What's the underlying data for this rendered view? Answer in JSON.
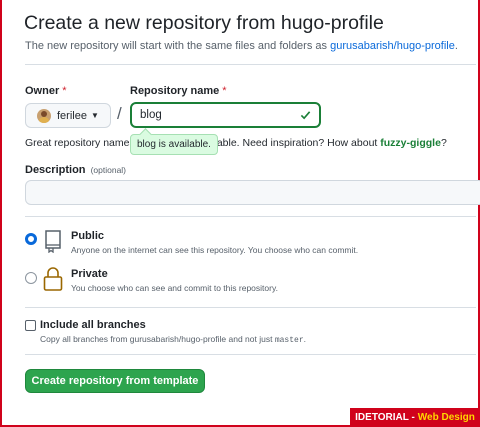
{
  "header": {
    "title": "Create a new repository from hugo-profile",
    "subtitle_prefix": "The new repository will start with the same files and folders as ",
    "subtitle_link": "gurusabarish/hugo-profile",
    "subtitle_suffix": "."
  },
  "owner": {
    "label": "Owner",
    "required_mark": "*",
    "value": "ferilee"
  },
  "repo_name": {
    "label": "Repository name",
    "required_mark": "*",
    "value": "blog"
  },
  "availability_tooltip": "blog is available.",
  "hint": {
    "prefix": "Great repository names ",
    "middle": "norable. Need inspiration? How about ",
    "suggestion": "fuzzy-giggle",
    "suffix": "?"
  },
  "description": {
    "label": "Description",
    "optional": "(optional)",
    "value": ""
  },
  "visibility": {
    "selected": "public",
    "public": {
      "title": "Public",
      "desc": "Anyone on the internet can see this repository. You choose who can commit."
    },
    "private": {
      "title": "Private",
      "desc": "You choose who can see and commit to this repository."
    }
  },
  "include_branches": {
    "label": "Include all branches",
    "checked": false,
    "desc_prefix": "Copy all branches from gurusabarish/hugo-profile and not just ",
    "desc_code": "master",
    "desc_suffix": "."
  },
  "create_button": "Create repository from template",
  "watermark": {
    "brand": "IDETORIAL - ",
    "sub": "Web Design"
  },
  "colors": {
    "accent_green": "#2da44e",
    "link_blue": "#0969da",
    "frame_red": "#d0021b"
  }
}
